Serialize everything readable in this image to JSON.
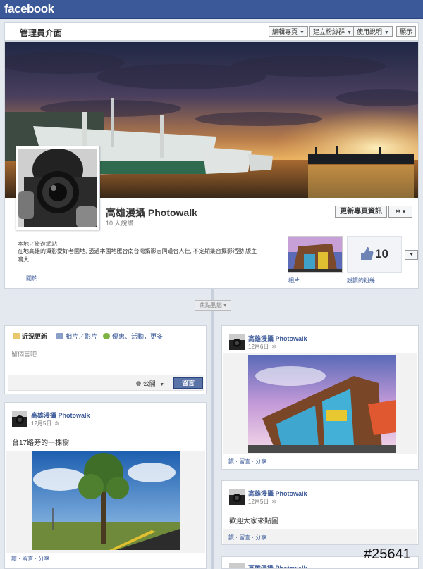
{
  "topbar": {
    "logo": "facebook"
  },
  "admin": {
    "title": "管理員介面",
    "buttons": [
      "編輯專頁",
      "建立粉絲群",
      "使用說明"
    ],
    "show_label": "顯示"
  },
  "page": {
    "name": "高雄漫攝 Photowalk",
    "likes_line": "10 人說讚",
    "update_info_label": "更新專頁資訊",
    "gear_label": "✲ ▾"
  },
  "about": {
    "category": "本地／旅遊網站",
    "description": "在地高雄的攝影愛好者園地, 透過本園地匯合南台灣攝影志同道合人仕, 不定期集合攝影活動 版主 鳴大",
    "link_label": "關於"
  },
  "thumbnails": {
    "photos_label": "相片",
    "likes_label": "說讚的粉絲",
    "like_count": "10"
  },
  "highlights_label": "焦點動態 ▾",
  "composer": {
    "tabs": [
      "近況更新",
      "相片／影片",
      "優惠、活動，更多"
    ],
    "placeholder": "留個言吧……",
    "privacy_label": "公開",
    "post_label": "留言"
  },
  "posts": [
    {
      "author": "高雄漫攝 Photowalk",
      "date": "12月5日",
      "text": "台17路旁的一棵樹",
      "actions": "讚 · 留言 · 分享"
    },
    {
      "author": "高雄漫攝 Photowalk",
      "date": "12月6日",
      "actions": "讚 · 留言 · 分享"
    },
    {
      "author": "高雄漫攝 Photowalk",
      "date": "12月5日",
      "text": "歡迎大家來貼圖",
      "actions": "讚 · 留言 · 分享"
    },
    {
      "author": "高雄漫攝 Photowalk"
    }
  ],
  "watermark": "#25641",
  "colors": {
    "brand": "#3b5998",
    "link": "#3b5998",
    "background": "#e4e8ef"
  },
  "icons": [
    "globe-icon",
    "gear-icon",
    "thumbs-up-icon",
    "status-icon",
    "photo-icon",
    "event-icon"
  ]
}
